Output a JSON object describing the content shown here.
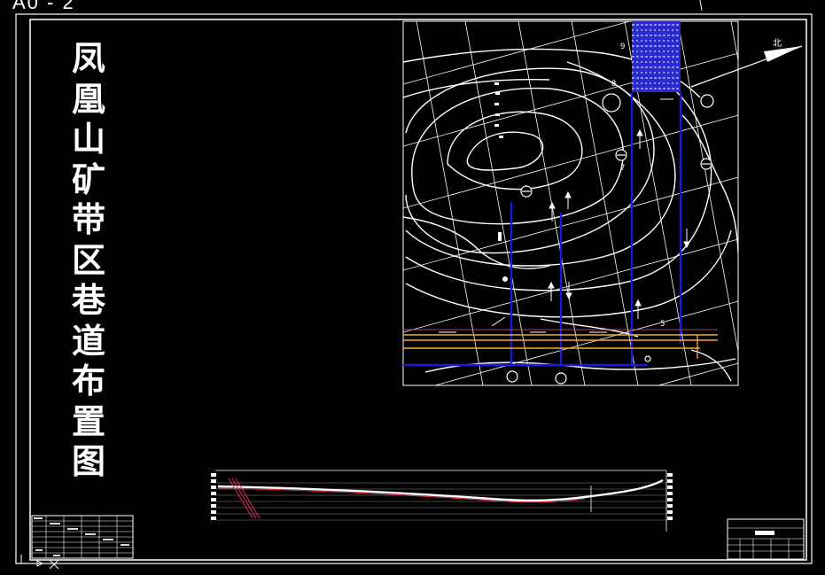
{
  "sheet": {
    "size_label": "A0 - 2"
  },
  "title": {
    "text": "凤凰山矿带区巷道布置图",
    "chars": [
      "凤",
      "凰",
      "山",
      "矿",
      "带",
      "区",
      "巷",
      "道",
      "布",
      "置",
      "图"
    ]
  },
  "map": {
    "point_labels": [
      "9",
      "8",
      "7",
      "5"
    ],
    "north_label": "北",
    "colors": {
      "background": "#000000",
      "contours": "#ffffff",
      "roadways": "#1a1ad8",
      "haulage_level": "#f2a93b",
      "ore_block": "#2a2ad0"
    }
  },
  "cad": {
    "ucs_icon": "ucs-axis-icon",
    "crosshair_icon": "crosshair-cursor-icon"
  }
}
